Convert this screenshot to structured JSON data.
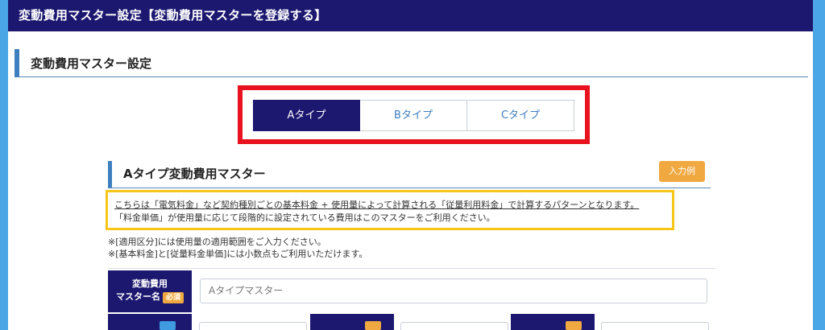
{
  "header": {
    "title": "変動費用マスター設定【変動費用マスターを登録する】"
  },
  "section": {
    "title": "変動費用マスター設定"
  },
  "tabs": [
    {
      "label": "Aタイプ",
      "active": true
    },
    {
      "label": "Bタイプ",
      "active": false
    },
    {
      "label": "Cタイプ",
      "active": false
    }
  ],
  "subsection": {
    "title": "Aタイプ変動費用マスター",
    "example_button": "入力例"
  },
  "description": {
    "line1": "こちらは「電気料金」など契約種別ごとの基本料金 + 使用量によって計算される「従量利用料金」で計算するパターンとなります。",
    "line2": "「料金単価」が使用量に応じて段階的に設定されている費用はこのマスターをご利用ください。"
  },
  "notes": {
    "line1": "※[適用区分]には使用量の適用範囲をご入力ください。",
    "line2": "※[基本料金]と[従量料金単価]には小数点もご利用いただけます。"
  },
  "form": {
    "name_label_line1": "変動費用",
    "name_label_line2": "マスター名",
    "required_badge": "必須",
    "name_value": "Aタイプマスター"
  },
  "colors": {
    "navy": "#1c1870",
    "accent_blue": "#3e7fbf",
    "orange": "#f0a940",
    "highlight_red": "#e8131e",
    "highlight_yellow": "#f5c518"
  }
}
